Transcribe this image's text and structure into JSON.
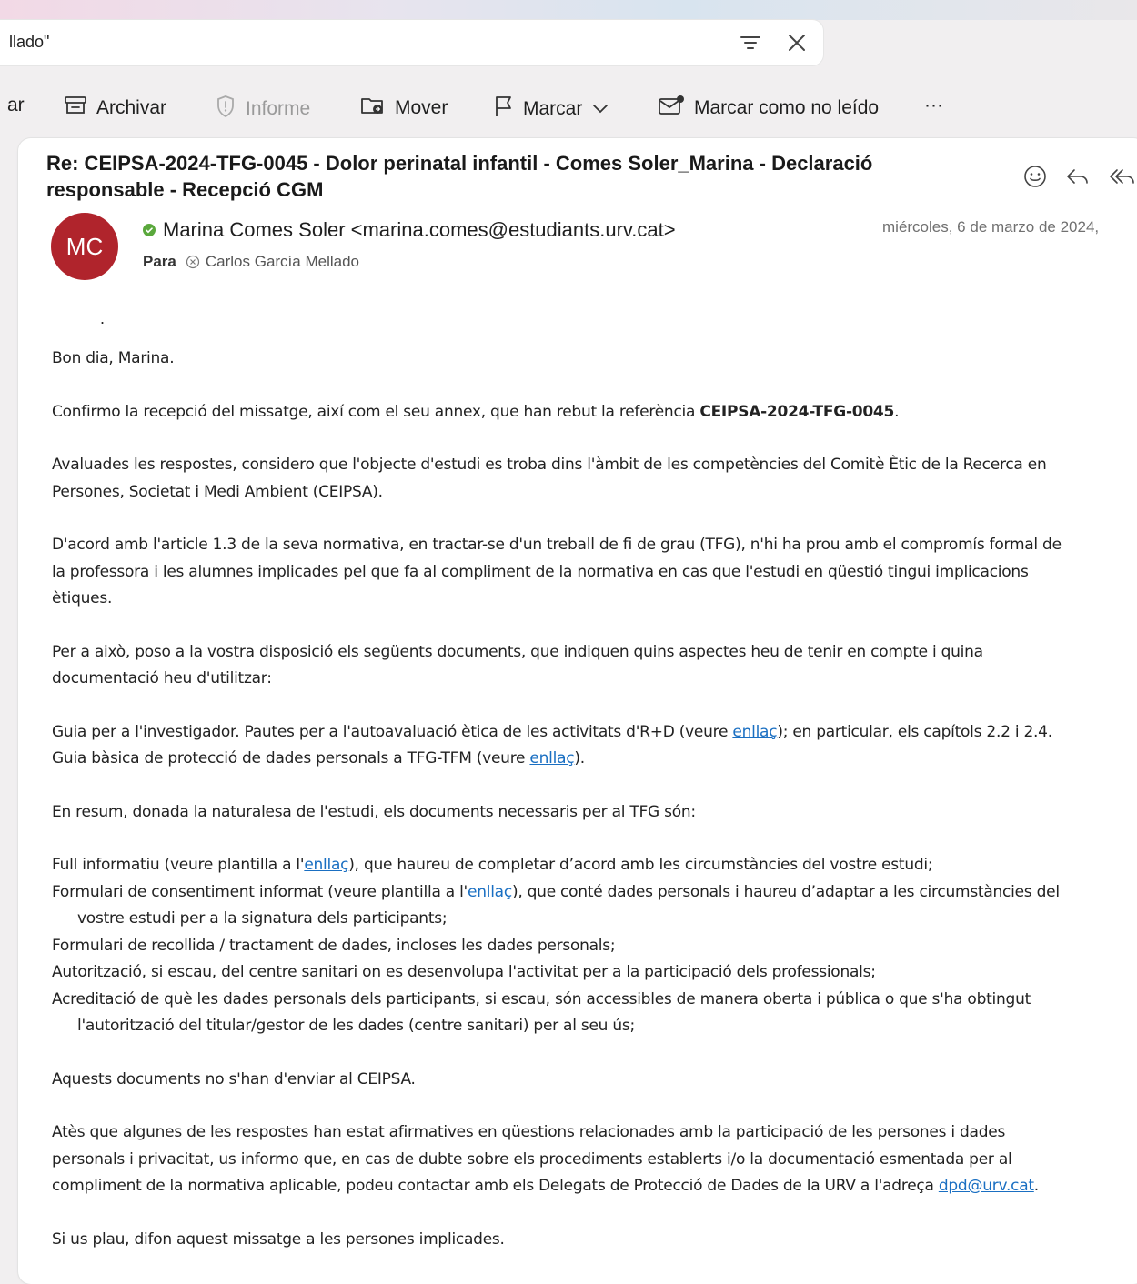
{
  "search": {
    "query": "llado\""
  },
  "toolbar": {
    "left_cut": "ar",
    "archive": "Archivar",
    "report": "Informe",
    "move": "Mover",
    "flag": "Marcar",
    "mark_unread": "Marcar como no leído",
    "more": "···"
  },
  "message": {
    "subject_line1": "Re: CEIPSA-2024-TFG-0045 - Dolor perinatal infantil - Comes Soler_Marina - Declaració",
    "subject_line2": "responsable - Recepció CGM",
    "sender_initials": "MC",
    "sender": "Marina Comes Soler <marina.comes@estudiants.urv.cat>",
    "date": "miércoles, 6 de marzo de 2024,",
    "to_label": "Para",
    "recipient": "Carlos García Mellado",
    "body": {
      "dot": ".",
      "greeting": "Bon dia, Marina.",
      "p1_pre": "Confirmo la recepció del missatge, així com el seu annex, que han rebut la referència ",
      "p1_ref": "CEIPSA-2024-TFG-0045",
      "p1_post": ".",
      "p2_l1": "Avaluades les respostes, considero que l'objecte d'estudi es troba dins l'àmbit de les competències del Comitè Ètic de la Recerca en",
      "p2_l2": "Persones, Societat i Medi Ambient (CEIPSA).",
      "p3_l1": "D'acord amb l'article 1.3 de la seva normativa, en tractar-se d'un treball de fi de grau (TFG), n'hi ha prou amb el compromís formal de",
      "p3_l2": "la professora i les alumnes implicades pel que fa al compliment de la normativa en cas que l'estudi en qüestió tingui implicacions",
      "p3_l3": "ètiques.",
      "p4_l1": "Per a això, poso a la vostra disposició els següents documents, que indiquen quins aspectes heu de tenir en compte i quina",
      "p4_l2": "documentació heu d'utilitzar:",
      "g1_pre": "Guia per a l'investigador. Pautes per a l'autoavaluació ètica de les activitats d'R+D (veure ",
      "link": "enllaç",
      "g1_post": "); en particular, els capítols 2.2 i 2.4.",
      "g2_pre": "Guia bàsica de protecció de dades personals a TFG-TFM (veure ",
      "g2_post": ").",
      "summary": "En resum, donada la naturalesa de l'estudi, els documents necessaris per al TFG són:",
      "d1_pre": "Full informatiu (veure plantilla a l'",
      "d1_post": "), que haureu de completar d’acord amb les circumstàncies del vostre estudi;",
      "d2_pre": "Formulari de consentiment informat (veure plantilla a l'",
      "d2_post": "), que conté dades personals i haureu d’adaptar a les circumstàncies del",
      "d2_l2": "vostre estudi per a la signatura dels participants;",
      "d3": "Formulari de recollida / tractament de dades, incloses les dades personals;",
      "d4": "Autorització, si escau, del centre sanitari on es desenvolupa l'activitat per a la participació dels professionals;",
      "d5_l1": "Acreditació de què les dades personals dels participants, si escau, són accessibles de manera oberta i pública o que s'ha obtingut",
      "d5_l2": "l'autorització del titular/gestor de les dades (centre sanitari) per al seu ús;",
      "not_send": "Aquests documents no s'han d'enviar al CEIPSA.",
      "p5_l1": "Atès que algunes de les respostes han estat afirmatives en qüestions relacionades amb la participació de les persones i dades",
      "p5_l2": "personals i privacitat, us informo que, en cas de dubte sobre els procediments establerts i/o la documentació esmentada per al",
      "p5_l3_pre": "compliment de la normativa aplicable, podeu contactar amb els Delegats de Protecció de Dades de la URV a l'adreça ",
      "email": "dpd@urv.cat",
      "p5_l3_post": ".",
      "closing": "Si us plau, difon aquest missatge a les persones implicades."
    }
  },
  "colors": {
    "avatar": "#b0242c",
    "link": "#1a6fc2",
    "presence": "#5aa83c"
  }
}
